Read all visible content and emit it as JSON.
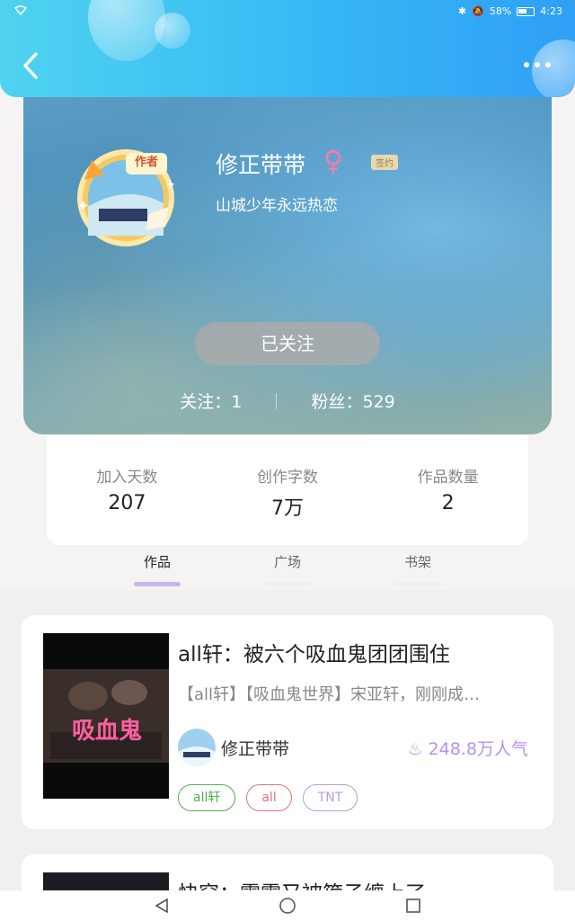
{
  "status_bar": {
    "battery": "58%",
    "time": "4:23"
  },
  "profile": {
    "name": "修正带带",
    "badge": "签约",
    "motto": "山城少年永远热恋",
    "avatar_text": "作者",
    "follow_label": "已关注",
    "following_label": "关注：1",
    "fans_label": "粉丝：529"
  },
  "stats": [
    {
      "label": "加入天数",
      "value": "207"
    },
    {
      "label": "创作字数",
      "value": "7万"
    },
    {
      "label": "作品数量",
      "value": "2"
    }
  ],
  "tabs": [
    {
      "label": "作品",
      "active": true
    },
    {
      "label": "广场",
      "active": false
    },
    {
      "label": "书架",
      "active": false
    }
  ],
  "books": [
    {
      "title": "all轩：被六个吸血鬼团团围住",
      "description": "【all轩】【吸血鬼世界】宋亚轩，刚刚成…",
      "cover_text": "吸血鬼",
      "author": "修正带带",
      "popularity": "248.8万人气",
      "tags": [
        {
          "label": "all轩",
          "color": "#4caf50"
        },
        {
          "label": "all",
          "color": "#e57373"
        },
        {
          "label": "TNT",
          "color": "#b39ddb"
        }
      ]
    },
    {
      "title": "快穿：霖霖又被箍子缠上了"
    }
  ],
  "colors": {
    "accent_purple": "#c8b4ea",
    "popularity": "#b692f0",
    "topbar": "#37b8f5"
  }
}
